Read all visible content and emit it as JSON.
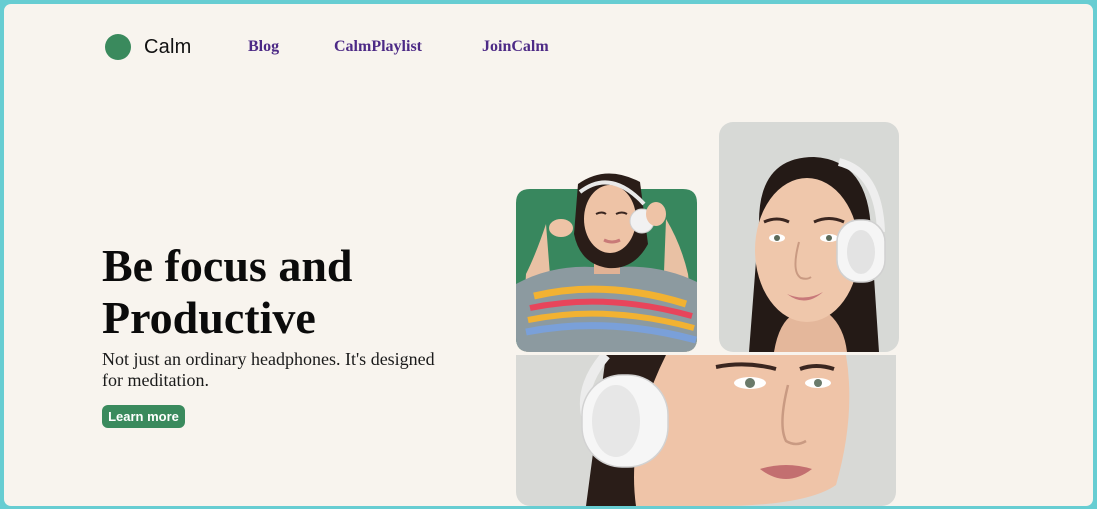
{
  "brand": {
    "name": "Calm",
    "color": "#3a8a5d"
  },
  "nav": {
    "links": [
      {
        "label": "Blog"
      },
      {
        "label": "CalmPlaylist"
      },
      {
        "label": "JoinCalm"
      }
    ],
    "link_color": "#4d2a86"
  },
  "hero": {
    "title": "Be focus and Productive",
    "subtitle": "Not just an ordinary headphones. It's designed for meditation.",
    "cta_label": "Learn more"
  },
  "images": {
    "a": {
      "alt": "woman-headphones-green"
    },
    "b": {
      "alt": "woman-headphones-portrait"
    },
    "c": {
      "alt": "woman-headphones-closeup"
    }
  },
  "colors": {
    "page_bg": "#f8f4ee",
    "outer_bg": "#67cdd2",
    "accent_green": "#3a8a5d"
  }
}
